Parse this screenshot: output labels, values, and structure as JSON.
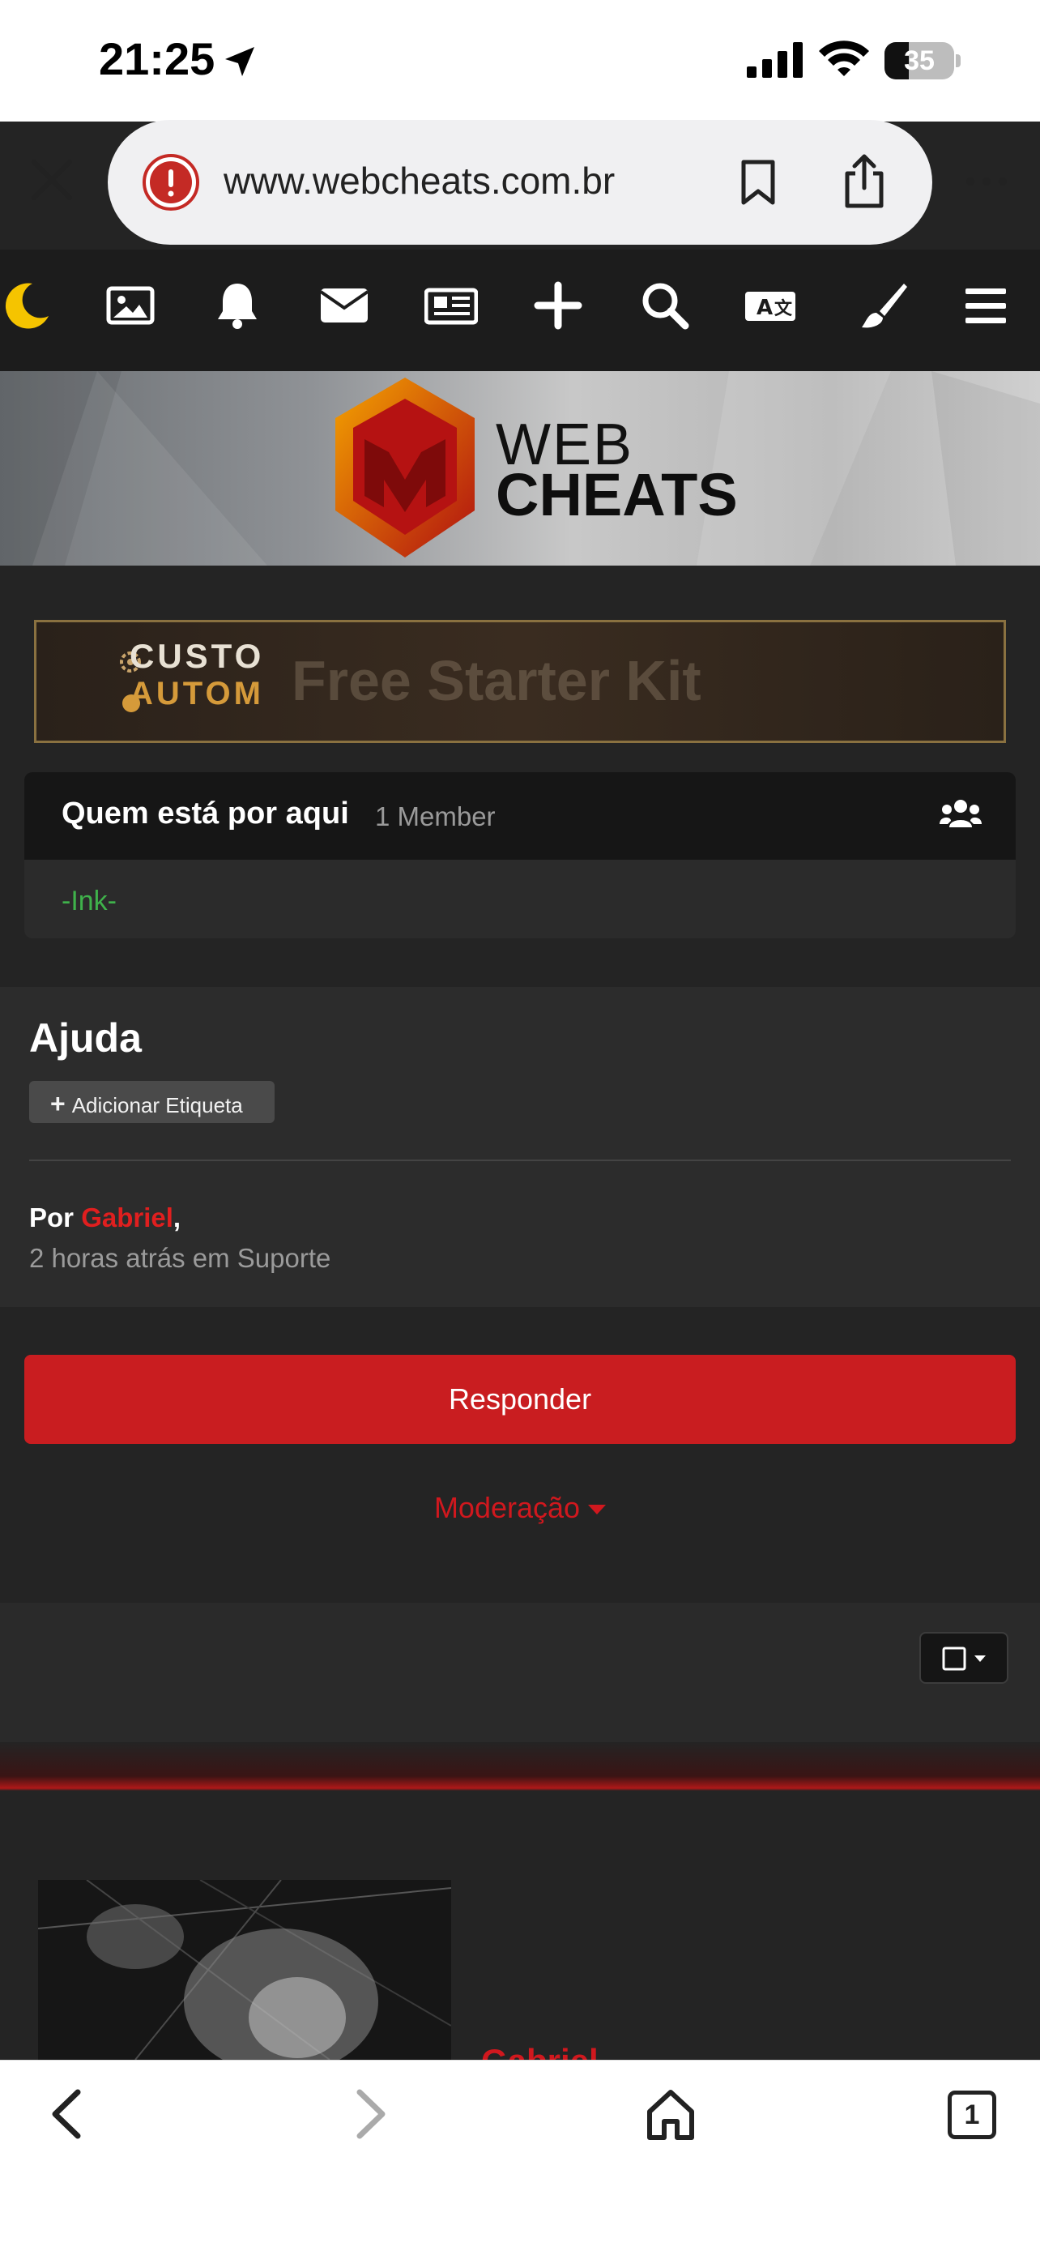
{
  "status_bar": {
    "time": "21:25",
    "battery": "35"
  },
  "browser": {
    "url": "www.webcheats.com.br",
    "tab_count": "1"
  },
  "site": {
    "toolbar_icons": [
      "moon-icon",
      "image-icon",
      "bell-icon",
      "mail-icon",
      "news-icon",
      "plus-icon",
      "search-icon",
      "translate-icon",
      "brush-icon",
      "menu-icon"
    ],
    "logo_top": "WEB",
    "logo_bottom": "CHEATS",
    "accent": "#c91d20"
  },
  "ad": {
    "line1": "CUSTO",
    "line2": "AUTOM",
    "faint": "Free Starter Kit"
  },
  "online": {
    "title": "Quem está por aqui",
    "count": "1 Member",
    "users": [
      "-Ink-"
    ]
  },
  "topic": {
    "title": "Ajuda",
    "add_tag": "Adicionar Etiqueta",
    "by_label": "Por",
    "author": "Gabriel",
    "meta": "2 horas atrás em Suporte"
  },
  "actions": {
    "reply": "Responder",
    "moderation": "Moderação"
  },
  "post": {
    "author": "Gabriel"
  }
}
